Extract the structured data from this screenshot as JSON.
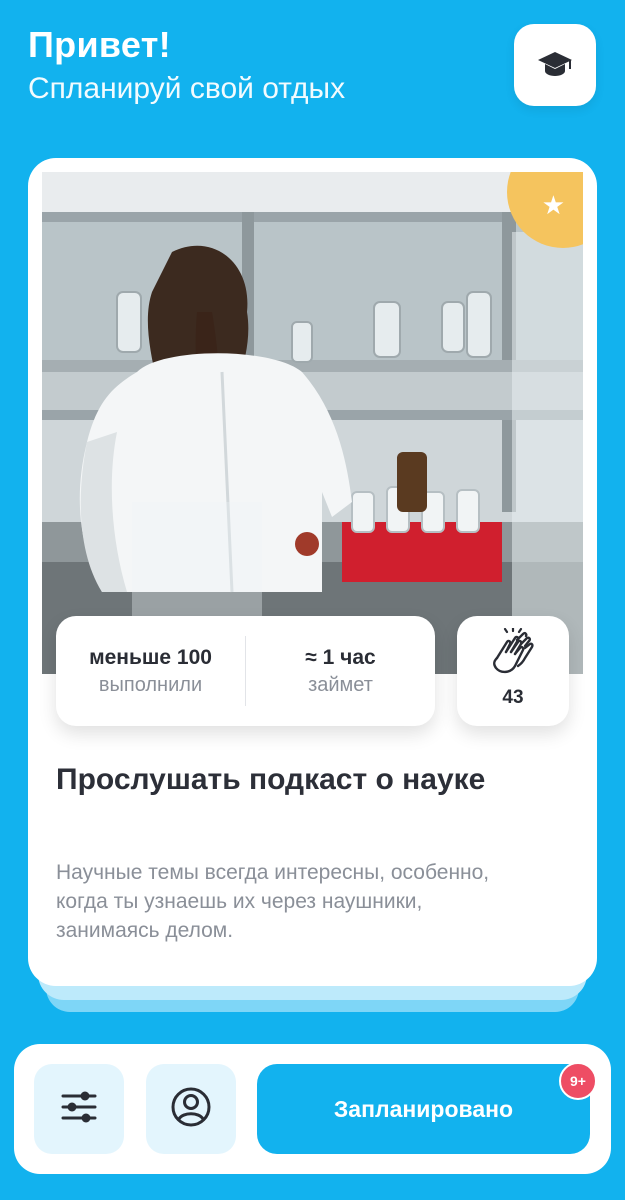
{
  "header": {
    "title": "Привет!",
    "subtitle": "Спланируй свой отдых",
    "learn_icon": "graduation-cap-icon"
  },
  "card": {
    "favorite_icon": "star-icon",
    "image_alt": "Laboratory photo",
    "stats": [
      {
        "value": "меньше 100",
        "label": "выполнили"
      },
      {
        "value": "≈ 1 час",
        "label": "займет"
      }
    ],
    "claps": {
      "icon": "clapping-hands-icon",
      "count": "43"
    },
    "title": "Прослушать подкаст о науке",
    "description": "Научные темы всегда интересны, особенно, когда ты узнаешь их через наушники, занимаясь делом."
  },
  "bottom_bar": {
    "filters_icon": "sliders-icon",
    "profile_icon": "user-circle-icon",
    "planned_label": "Запланировано",
    "badge": "9+"
  },
  "colors": {
    "background": "#12b2ee",
    "accent_badge": "#f5c45e",
    "notification": "#ee4d64"
  }
}
